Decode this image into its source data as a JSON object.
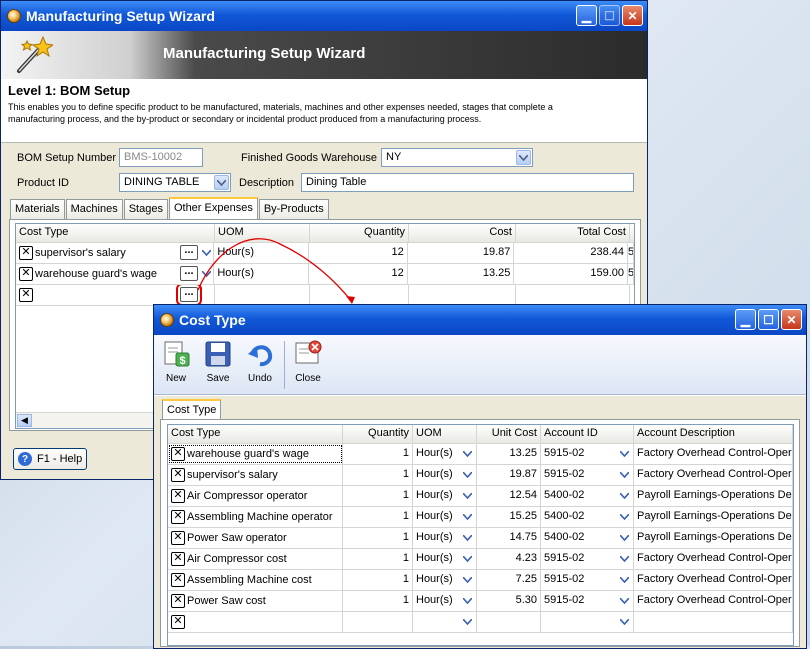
{
  "main_window": {
    "title": "Manufacturing Setup Wizard",
    "banner_title": "Manufacturing Setup Wizard",
    "level_title": "Level 1: BOM Setup",
    "description": "This enables you to define specific product to be manufactured, materials, machines and other expenses needed, stages that complete a manufacturing process, and the by-product or secondary or incidental product produced from a manufacturing process.",
    "bom_setup_number_label": "BOM Setup Number",
    "bom_setup_number_value": "BMS-10002",
    "finished_goods_warehouse_label": "Finished Goods Warehouse",
    "finished_goods_warehouse_value": "NY",
    "product_id_label": "Product ID",
    "product_id_value": "DINING TABLE",
    "description_label": "Description",
    "description_value": "Dining Table",
    "tabs": [
      "Materials",
      "Machines",
      "Stages",
      "Other Expenses",
      "By-Products"
    ],
    "active_tab": "Other Expenses",
    "grid_headers": [
      "Cost Type",
      "UOM",
      "Quantity",
      "Cost",
      "Total Cost"
    ],
    "grid_rows": [
      {
        "cost_type": "supervisor's salary",
        "uom": "Hour(s)",
        "quantity": "12",
        "cost": "19.87",
        "total_cost": "238.44",
        "extra": "5"
      },
      {
        "cost_type": "warehouse guard's wage",
        "uom": "Hour(s)",
        "quantity": "12",
        "cost": "13.25",
        "total_cost": "159.00",
        "extra": "5"
      }
    ],
    "help_button": "F1 - Help",
    "ellipsis": "..."
  },
  "popup": {
    "title": "Cost Type",
    "toolbar": {
      "new": "New",
      "save": "Save",
      "undo": "Undo",
      "close": "Close"
    },
    "tab": "Cost Type",
    "headers": [
      "Cost Type",
      "Quantity",
      "UOM",
      "Unit Cost",
      "Account ID",
      "Account Description"
    ],
    "rows": [
      {
        "cost_type": "warehouse guard's wage",
        "quantity": "1",
        "uom": "Hour(s)",
        "unit_cost": "13.25",
        "account_id": "5915-02",
        "account_desc": "Factory Overhead Control-Oper"
      },
      {
        "cost_type": "supervisor's salary",
        "quantity": "1",
        "uom": "Hour(s)",
        "unit_cost": "19.87",
        "account_id": "5915-02",
        "account_desc": "Factory Overhead Control-Oper"
      },
      {
        "cost_type": "Air Compressor operator",
        "quantity": "1",
        "uom": "Hour(s)",
        "unit_cost": "12.54",
        "account_id": "5400-02",
        "account_desc": "Payroll Earnings-Operations Dep"
      },
      {
        "cost_type": "Assembling Machine operator",
        "quantity": "1",
        "uom": "Hour(s)",
        "unit_cost": "15.25",
        "account_id": "5400-02",
        "account_desc": "Payroll Earnings-Operations Dep"
      },
      {
        "cost_type": "Power Saw operator",
        "quantity": "1",
        "uom": "Hour(s)",
        "unit_cost": "14.75",
        "account_id": "5400-02",
        "account_desc": "Payroll Earnings-Operations Dep"
      },
      {
        "cost_type": "Air Compressor cost",
        "quantity": "1",
        "uom": "Hour(s)",
        "unit_cost": "4.23",
        "account_id": "5915-02",
        "account_desc": "Factory Overhead Control-Oper"
      },
      {
        "cost_type": "Assembling Machine cost",
        "quantity": "1",
        "uom": "Hour(s)",
        "unit_cost": "7.25",
        "account_id": "5915-02",
        "account_desc": "Factory Overhead Control-Oper"
      },
      {
        "cost_type": "Power Saw cost",
        "quantity": "1",
        "uom": "Hour(s)",
        "unit_cost": "5.30",
        "account_id": "5915-02",
        "account_desc": "Factory Overhead Control-Oper"
      }
    ]
  },
  "colors": {
    "titlebar": "#0a47c4",
    "annotation": "#e00000",
    "tab_highlight": "#ffc83c"
  }
}
